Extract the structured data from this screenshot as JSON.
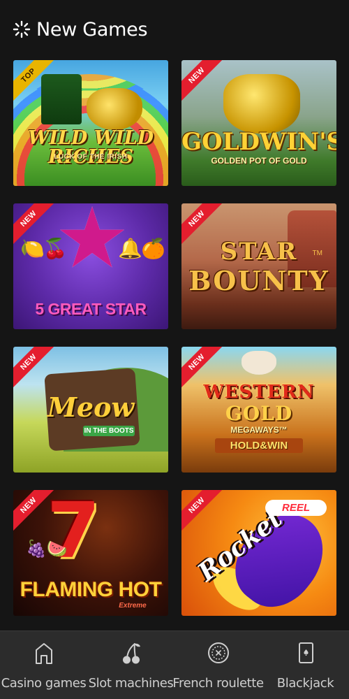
{
  "header": {
    "title": "New Games",
    "icon": "loading-sparkle-icon"
  },
  "games": [
    {
      "badge": "TOP",
      "title": "WILD WILD RICHES",
      "subtitle": "LUCK OF THE IRISH"
    },
    {
      "badge": "NEW",
      "title": "GOLDWIN'S",
      "subtitle": "GOLDEN POT OF GOLD"
    },
    {
      "badge": "NEW",
      "title": "5 GREAT STAR"
    },
    {
      "badge": "NEW",
      "title": "STAR",
      "title2": "BOUNTY",
      "tm": "TM"
    },
    {
      "badge": "NEW",
      "title": "Meow",
      "subtitle": "IN THE BOOTS"
    },
    {
      "badge": "NEW",
      "title": "WESTERN",
      "title2": "GOLD",
      "subtitle": "MEGAWAYS™",
      "subtitle2": "HOLD&WIN"
    },
    {
      "badge": "NEW",
      "title": "FLAMING HOT",
      "subtitle": "Extreme",
      "symbol": "7"
    },
    {
      "badge": "NEW",
      "title": "Rocket",
      "subtitle": "REEL"
    }
  ],
  "nav": [
    {
      "label": "Casino games",
      "icon": "home-icon"
    },
    {
      "label": "Slot machines",
      "icon": "cherry-icon"
    },
    {
      "label": "French roulette",
      "icon": "roulette-icon"
    },
    {
      "label": "Blackjack",
      "icon": "playing-card-icon"
    }
  ]
}
